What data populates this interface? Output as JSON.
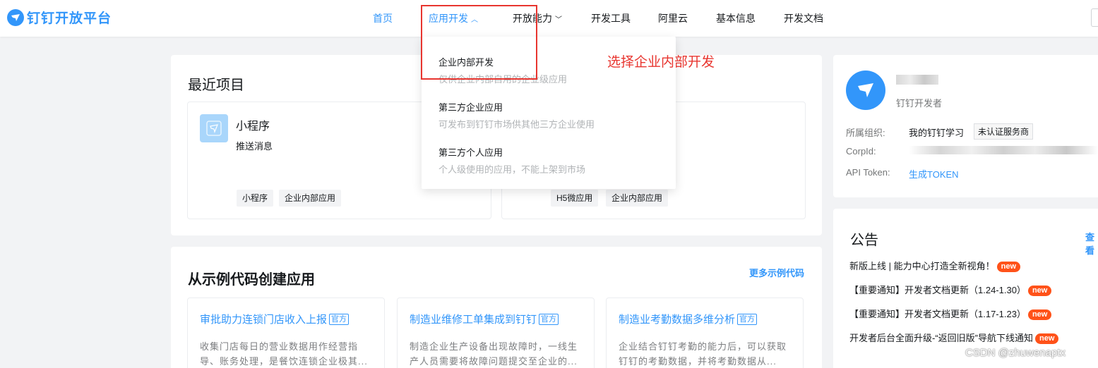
{
  "header": {
    "logo_text": "钉钉开放平台",
    "nav": {
      "home": "首页",
      "app_dev": "应用开发",
      "open_ability": "开放能力",
      "dev_tools": "开发工具",
      "aliyun": "阿里云",
      "basic_info": "基本信息",
      "dev_docs": "开发文档"
    }
  },
  "dropdown": {
    "items": [
      {
        "title": "企业内部开发",
        "desc": "仅供企业内部自用的企业级应用"
      },
      {
        "title": "第三方企业应用",
        "desc": "可发布到钉钉市场供其他三方企业使用"
      },
      {
        "title": "第三方个人应用",
        "desc": "个人级使用的应用，不能上架到市场"
      }
    ]
  },
  "annotation": "选择企业内部开发",
  "recent": {
    "title": "最近项目",
    "projects": [
      {
        "name": "小程序",
        "desc": "推送消息",
        "tags": [
          "小程序",
          "企业内部应用"
        ]
      },
      {
        "name": "",
        "desc": "",
        "tags": [
          "H5微应用",
          "企业内部应用"
        ]
      }
    ]
  },
  "examples": {
    "title": "从示例代码创建应用",
    "more": "更多示例代码",
    "badge": "官方",
    "items": [
      {
        "name": "审批助力连锁门店收入上报",
        "desc": "收集门店每日的营业数据用作经营指导、账务处理，是餐饮连锁企业极其..."
      },
      {
        "name": "制造业维修工单集成到钉钉",
        "desc": "制造企业生产设备出现故障时，一线生产人员需要将故障问题提交至企业的..."
      },
      {
        "name": "制造业考勤数据多维分析",
        "desc": "企业结合钉钉考勤的能力后，可以获取钉钉的考勤数据，并将考勤数据从..."
      }
    ]
  },
  "profile": {
    "role": "钉钉开发者",
    "org_label": "所属组织:",
    "org_value": "我的钉钉学习",
    "org_badge": "未认证服务商",
    "corp_label": "CorpId:",
    "token_label": "API Token:",
    "token_link": "生成TOKEN"
  },
  "notice": {
    "title": "公告",
    "more": "查看",
    "new_label": "new",
    "items": [
      "新版上线 | 能力中心打造全新视角！",
      "【重要通知】开发者文档更新（1.24-1.30）",
      "【重要通知】开发者文档更新（1.17-1.23）",
      "开发者后台全面升级-“返回旧版”导航下线通知"
    ]
  },
  "watermark": "CSDN @zhuwenaptx",
  "colors": {
    "accent": "#3296fa",
    "annotation": "#e8352f",
    "new_badge": "#ff5219"
  }
}
